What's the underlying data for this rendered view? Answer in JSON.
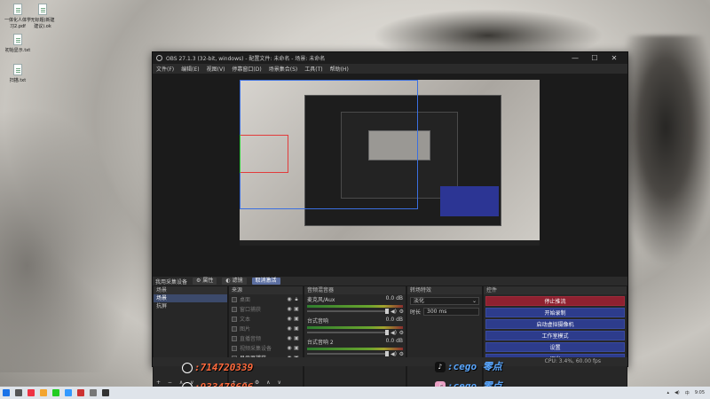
{
  "desktop": {
    "icons": [
      {
        "label": "一体化人体学\n习2.pdf"
      },
      {
        "label": "无标题(新建\n建议).ok"
      },
      {
        "label": "初始显示.txt"
      },
      {
        "label": "扫描.txt"
      }
    ]
  },
  "obs": {
    "title": "OBS 27.1.3 (32-bit, windows) - 配置文件: 未命名 - 场景: 未命名",
    "window_controls": {
      "minimize": "—",
      "maximize": "☐",
      "close": "✕"
    },
    "menu": [
      "文件(F)",
      "编辑(E)",
      "视图(V)",
      "停靠窗口(D)",
      "场景集合(S)",
      "工具(T)",
      "帮助(H)"
    ],
    "context_bar": {
      "source": "我用采集设备",
      "props": "属性",
      "filters": "滤镜",
      "deactivate": "取消激活"
    },
    "scenes": {
      "header": "场景",
      "items": [
        "场景",
        "抗屏"
      ],
      "footer": "+ − ∧ ∨"
    },
    "sources": {
      "header": "来源",
      "items": [
        {
          "label": "桌面"
        },
        {
          "label": "窗口捕获"
        },
        {
          "label": "文本"
        },
        {
          "label": "图片"
        },
        {
          "label": "直播音频"
        },
        {
          "label": "视频采集设备"
        },
        {
          "label": "显示器捕获"
        }
      ],
      "footer": "+ − ⚙ ∧ ∨"
    },
    "mixer": {
      "header": "音频混音器",
      "channels": [
        {
          "name": "麦克风/Aux",
          "db": "0.0 dB"
        },
        {
          "name": "台式音响",
          "db": "0.0 dB"
        },
        {
          "name": "台式音响 2",
          "db": "0.0 dB"
        }
      ]
    },
    "transitions": {
      "header": "转场特效",
      "type": "淡化",
      "duration_label": "时长",
      "duration": "300 ms"
    },
    "controls": {
      "header": "控件",
      "buttons": [
        "停止推流",
        "开始录制",
        "启动虚拟摄像机",
        "工作室模式",
        "设置",
        "退出"
      ]
    },
    "status": "CPU: 3.4%, 60.00 fps"
  },
  "overlays": {
    "qq1": ":714720339",
    "qq2": ":933478606",
    "tiktok1": ":cego  零点",
    "tiktok2": ":cego  零点"
  },
  "taskbar": {
    "time": "9:05",
    "lang": "中"
  },
  "colors": {
    "accent_red": "#8f2130",
    "accent_blue": "#2d3c8c",
    "select_red": "#e23b3b",
    "select_blue": "#3b6fe0"
  }
}
